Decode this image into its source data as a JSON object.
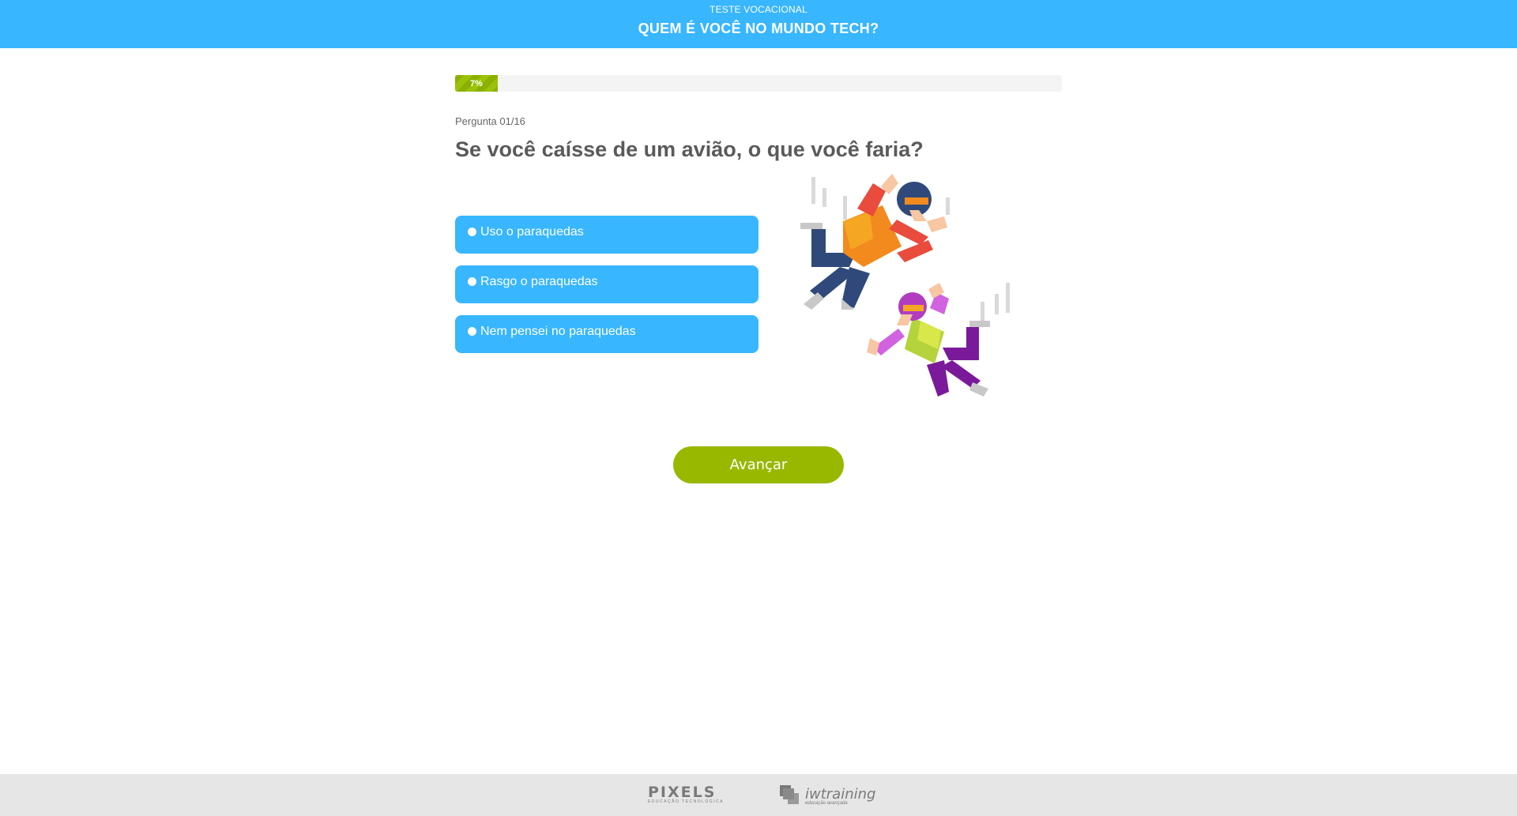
{
  "header": {
    "eyebrow": "TESTE VOCACIONAL",
    "title": "QUEM É VOCÊ NO MUNDO TECH?",
    "background": "#38b6ff"
  },
  "progress": {
    "label": "7%",
    "fraction": 0.07
  },
  "question": {
    "counter": "Pergunta 01/16",
    "text": "Se você caísse de um avião, o que você faria?"
  },
  "options": [
    {
      "label": "Uso o paraquedas"
    },
    {
      "label": "Rasgo o paraquedas"
    },
    {
      "label": "Nem pensei no paraquedas"
    }
  ],
  "actions": {
    "next_label": "Avançar",
    "next_color": "#98b800"
  },
  "footer": {
    "logo1": "PIXELS",
    "logo1_sub": "EDUCAÇÃO TECNOLÓGICA",
    "logo2": "iwtraining",
    "logo2_sub": "educação avançada"
  },
  "illustration": {
    "icon": "skydivers-illustration"
  }
}
